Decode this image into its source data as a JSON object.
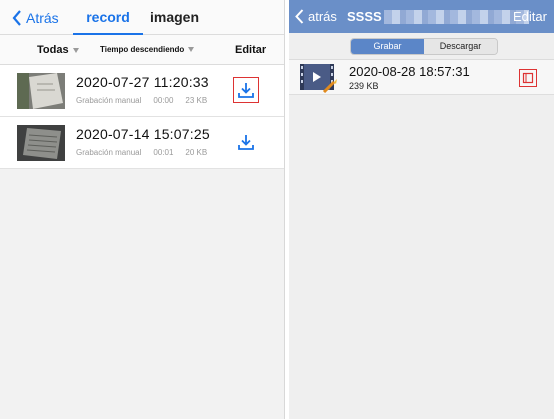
{
  "left": {
    "back_label": "Atrás",
    "tabs": [
      {
        "label": "record",
        "active": true
      },
      {
        "label": "imagen",
        "active": false
      }
    ],
    "filters": {
      "type_label": "Todas",
      "sort_label": "Tiempo descendiendo",
      "edit_label": "Editar"
    },
    "items": [
      {
        "datetime": "2020-07-27  11:20:33",
        "kind": "Grabación manual",
        "duration": "00:00",
        "size": "23 KB",
        "download_icon": "download-icon",
        "highlighted": true
      },
      {
        "datetime": "2020-07-14  15:07:25",
        "kind": "Grabación manual",
        "duration": "00:01",
        "size": "20 KB",
        "download_icon": "download-icon",
        "highlighted": false
      }
    ]
  },
  "right": {
    "back_label": "atrás",
    "title": "SSSS",
    "edit_label": "Editar",
    "segments": [
      {
        "label": "Grabar",
        "active": true
      },
      {
        "label": "Descargar",
        "active": false
      }
    ],
    "items": [
      {
        "datetime": "2020-08-28  18:57:31",
        "size": "239 KB"
      }
    ]
  },
  "colors": {
    "accent": "#1a73e8",
    "nav_right": "#6a8fc8",
    "segment_active": "#5b86c8",
    "highlight_box": "#dd3333"
  }
}
